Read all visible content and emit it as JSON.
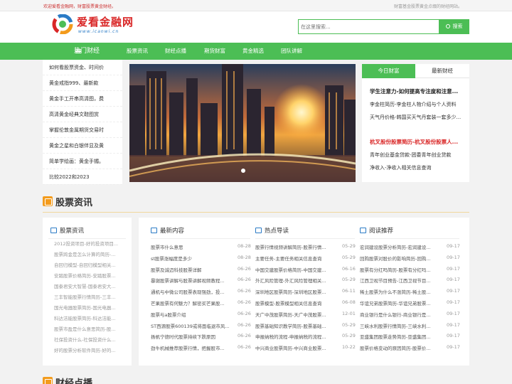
{
  "topbar": {
    "welcome": "欢迎爱看金融网，财富股票黄金财经。",
    "right": "财富基金股票黄金点缀的财经网站。"
  },
  "logo": {
    "title": "爱看金融网",
    "url": "www.icanwi.cn"
  },
  "search": {
    "placeholder": "在这里搜索...",
    "button": "搜索"
  },
  "nav": {
    "hot": "热门财经",
    "items": [
      "股票资讯",
      "财经点播",
      "期货财富",
      "黄金精选",
      "团队讲解"
    ]
  },
  "categories": [
    "如何看股票资金、时间价",
    "黄金戒指999、最新款",
    "黄金手工开串高清图，费",
    "高清黄金经典文鞋图赏",
    "掌握伦敦金属期货交易时",
    "黄金之星和白银伴显及黄",
    "简单学绘画：黄金手镯。",
    "比较2022和2023"
  ],
  "tabbox": {
    "tab_active": "今日财富",
    "tab_other": "最新财经",
    "items": [
      "学生注意力-如何提高专注度和注意...",
      "李金柱简历-李金柱人物介绍与个人资料",
      "天气丹价格-韩国买天气丹套装一套多少...",
      "杭叉股份股票简历-杭叉股份股票人...",
      "青年创业基金贷款-团委青年创业贷款",
      "净收入-净收入相关信息查询"
    ]
  },
  "section1": {
    "title": "股票资讯"
  },
  "left_panel": {
    "title": "股票资讯",
    "items": [
      "2012投资项目-好的投资项目...",
      "股票跨金是怎么计算的简历-...",
      "自回归模型-自回归模型相关...",
      "安踏股票价格简历-安踏股票...",
      "国泰君安大智慧-国泰君安大...",
      "三丰智能股票行情简历-三丰...",
      "国光电器股票简历-国光电器...",
      "科达洁能股票简历-科达洁能...",
      "股票市盈是什么意思简历-股...",
      "社保投资什么-社保投资什么...",
      "好的股票分析软件简历-好的..."
    ]
  },
  "col1": {
    "title": "最新内容",
    "items": [
      [
        "股票市什么意思",
        "08-28"
      ],
      [
        "st股票涨幅度是多少",
        "08-28"
      ],
      [
        "股票及诚迈科技股票详解",
        "06-26"
      ],
      [
        "暴谢股票讲解与股票讲解视频教程...",
        "06-26"
      ],
      [
        "通机与中微公司股票表现强劲，投...",
        "06-26"
      ],
      [
        "芒果股票有何魅力？解密买芒果股...",
        "06-26"
      ],
      [
        "股票与a股票介绍",
        "06-26"
      ],
      [
        "ST西源股票600139或将面临退市风...",
        "06-26"
      ],
      [
        "扬帆宁德时代股票持续下跌原因",
        "06-26"
      ],
      [
        "劲牛机械推荐股票行情，把握股市...",
        "06-26"
      ]
    ]
  },
  "col2": {
    "title": "热点导读",
    "items": [
      [
        "股票行情视频讲解简历-股票行情...",
        "05-29"
      ],
      [
        "主要任务-主要任务相关信息查询",
        "05-29"
      ],
      [
        "中国交建股票价格简历-中国交建...",
        "06-16"
      ],
      [
        "外汇风险管理-外汇风险管理相关...",
        "05-29"
      ],
      [
        "深圳地区股票简历-深圳地区股票...",
        "06-11"
      ],
      [
        "股票模型-股票模型相关信息查询",
        "06-08"
      ],
      [
        "天广中茂股票简历-天广中茂股票...",
        "12-01"
      ],
      [
        "股票基础知识教学简历-股票基础...",
        "05-29"
      ],
      [
        "申报纳税的流程-申报纳税的流程...",
        "05-29"
      ],
      [
        "中兴商业股票简历-中兴商业股票...",
        "10-22"
      ]
    ]
  },
  "col3": {
    "title": "阅读推荐",
    "items": [
      [
        "宏润建设股票分析简历-宏润建设...",
        "09-17"
      ],
      [
        "回购股票对股价的影响简历-回购...",
        "09-17"
      ],
      [
        "股票有分红吗简历-股票有分红吗...",
        "09-17"
      ],
      [
        "江西卫视节目预告-江西卫视节目...",
        "09-17"
      ],
      [
        "稀土股票为什么不涨简历-稀土股...",
        "09-17"
      ],
      [
        "华谊兄弟股票简历-华谊兄弟股票...",
        "09-17"
      ],
      [
        "商业银行是什么银行-商业银行是...",
        "09-17"
      ],
      [
        "三峡水利股票行情简历-三峡水利...",
        "09-17"
      ],
      [
        "亚盛集团股票走势简历-亚盛集团...",
        "09-17"
      ],
      [
        "股票价格变动的原因简历-股票价...",
        "09-17"
      ]
    ]
  },
  "section2": {
    "title": "财经点播"
  },
  "colors": {
    "green": "#4cbe55",
    "red": "#d92626",
    "orange": "#f39b1c",
    "blue": "#2b7bc6"
  }
}
